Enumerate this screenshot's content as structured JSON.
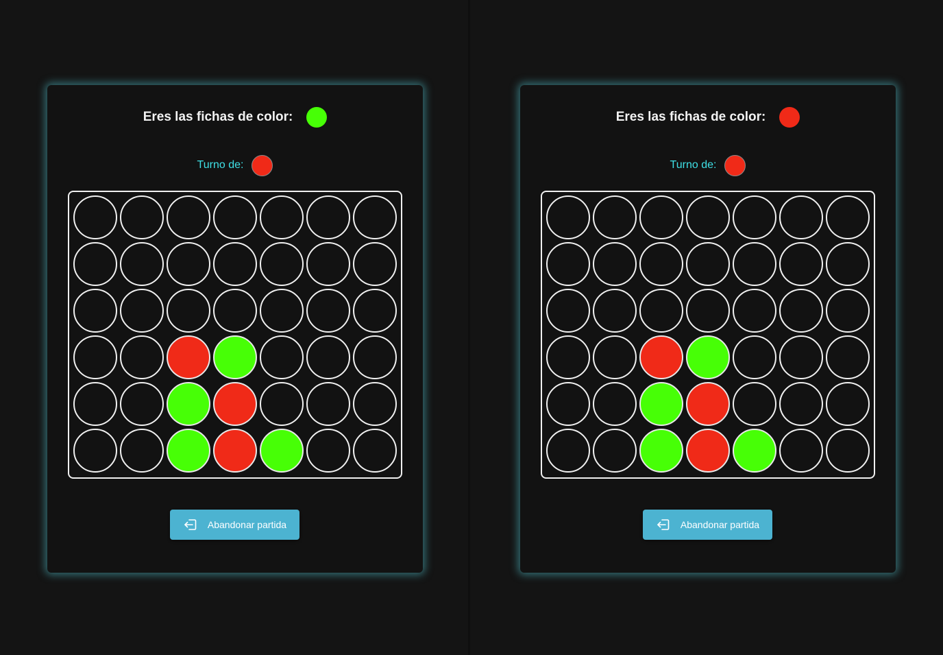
{
  "colors": {
    "red": "#f02a18",
    "green": "#47ff06",
    "accent": "#4cb3d1",
    "turn_text": "#3fe0e6"
  },
  "players": [
    {
      "header_label": "Eres las fichas de color:",
      "my_color": "green",
      "turn_label": "Turno de:",
      "turn_color": "red",
      "button_label": "Abandonar partida",
      "board": [
        [
          "",
          "",
          "",
          "",
          "",
          "",
          ""
        ],
        [
          "",
          "",
          "",
          "",
          "",
          "",
          ""
        ],
        [
          "",
          "",
          "",
          "",
          "",
          "",
          ""
        ],
        [
          "",
          "",
          "red",
          "green",
          "",
          "",
          ""
        ],
        [
          "",
          "",
          "green",
          "red",
          "",
          "",
          ""
        ],
        [
          "",
          "",
          "green",
          "red",
          "green",
          "",
          ""
        ]
      ]
    },
    {
      "header_label": "Eres las fichas de color:",
      "my_color": "red",
      "turn_label": "Turno de:",
      "turn_color": "red",
      "button_label": "Abandonar partida",
      "board": [
        [
          "",
          "",
          "",
          "",
          "",
          "",
          ""
        ],
        [
          "",
          "",
          "",
          "",
          "",
          "",
          ""
        ],
        [
          "",
          "",
          "",
          "",
          "",
          "",
          ""
        ],
        [
          "",
          "",
          "red",
          "green",
          "",
          "",
          ""
        ],
        [
          "",
          "",
          "green",
          "red",
          "",
          "",
          ""
        ],
        [
          "",
          "",
          "green",
          "red",
          "green",
          "",
          ""
        ]
      ]
    }
  ]
}
